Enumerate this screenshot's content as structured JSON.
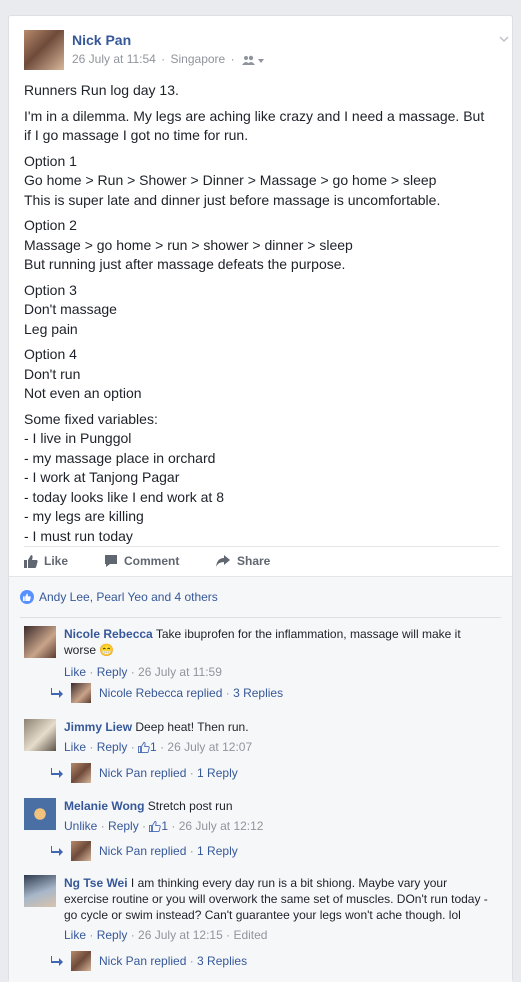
{
  "post": {
    "author": "Nick Pan",
    "date": "26 July at 11:54",
    "location": "Singapore",
    "paragraphs": [
      "Runners Run log day 13.",
      "I'm in a dilemma. My legs are aching like crazy and I need a massage. But\nif I go massage I got no time for run.",
      "Option 1\nGo home > Run > Shower > Dinner > Massage > go home > sleep\nThis is super late and dinner just before massage is uncomfortable.",
      "Option 2\nMassage > go home > run > shower > dinner > sleep\nBut running just after massage defeats the purpose.",
      "Option 3\nDon't massage\nLeg pain",
      "Option 4\nDon't run\nNot even an option",
      "Some fixed variables:\n- I live in Punggol\n- my massage place in orchard\n- I work at Tanjong Pagar\n- today looks like I end work at 8\n- my legs are killing\n- I must run today"
    ],
    "actions": {
      "like": "Like",
      "comment": "Comment",
      "share": "Share"
    },
    "likes_summary": "Andy Lee, Pearl Yeo and 4 others"
  },
  "comments": [
    {
      "name": "Nicole Rebecca",
      "text": "Take ibuprofen for the inflammation, massage will make it worse",
      "emoji": "😁",
      "action": "Like",
      "reply": "Reply",
      "like_count": "",
      "time": "26 July at 11:59",
      "edited": "",
      "replied_by": "Nicole Rebecca replied",
      "replies": "3 Replies"
    },
    {
      "name": "Jimmy Liew",
      "text": "Deep heat! Then run.",
      "emoji": "",
      "action": "Like",
      "reply": "Reply",
      "like_count": "1",
      "time": "26 July at 12:07",
      "edited": "",
      "replied_by": "Nick Pan replied",
      "replies": "1 Reply"
    },
    {
      "name": "Melanie Wong",
      "text": "Stretch post run",
      "emoji": "",
      "action": "Unlike",
      "reply": "Reply",
      "like_count": "1",
      "time": "26 July at 12:12",
      "edited": "",
      "replied_by": "Nick Pan replied",
      "replies": "1 Reply"
    },
    {
      "name": "Ng Tse Wei",
      "text": "I am thinking every day run is a bit shiong. Maybe vary your exercise routine or you will overwork the same set of muscles. DOn't run today - go cycle or swim instead? Can't guarantee your legs won't ache though. lol",
      "emoji": "",
      "action": "Like",
      "reply": "Reply",
      "like_count": "",
      "time": "26 July at 12:15",
      "edited": "Edited",
      "replied_by": "Nick Pan replied",
      "replies": "3 Replies"
    }
  ],
  "icons": {
    "audience": "friends-icon",
    "menu": "chevron-down-icon",
    "like": "thumbs-up-icon",
    "comment": "speech-bubble-icon",
    "share": "share-arrow-icon",
    "reply_arrow": "reply-arrow-icon"
  },
  "colors": {
    "link": "#365899",
    "meta": "#90949c",
    "text": "#1d2129",
    "like_badge": "#5890ff"
  }
}
